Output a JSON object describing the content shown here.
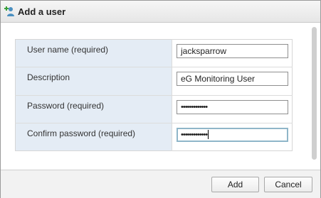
{
  "dialog": {
    "title": "Add a user",
    "icon": "add-user-icon"
  },
  "form": {
    "fields": [
      {
        "label": "User name (required)",
        "value": "jacksparrow"
      },
      {
        "label": "Description",
        "value": "eG Monitoring User"
      },
      {
        "label": "Password (required)",
        "value": "•••••••••••••"
      },
      {
        "label": "Confirm password (required)",
        "value": "•••••••••••••"
      }
    ]
  },
  "buttons": {
    "add_label": "Add",
    "cancel_label": "Cancel"
  },
  "colors": {
    "label_background": "#e4ecf5",
    "focus_border": "#8fb6c9"
  }
}
